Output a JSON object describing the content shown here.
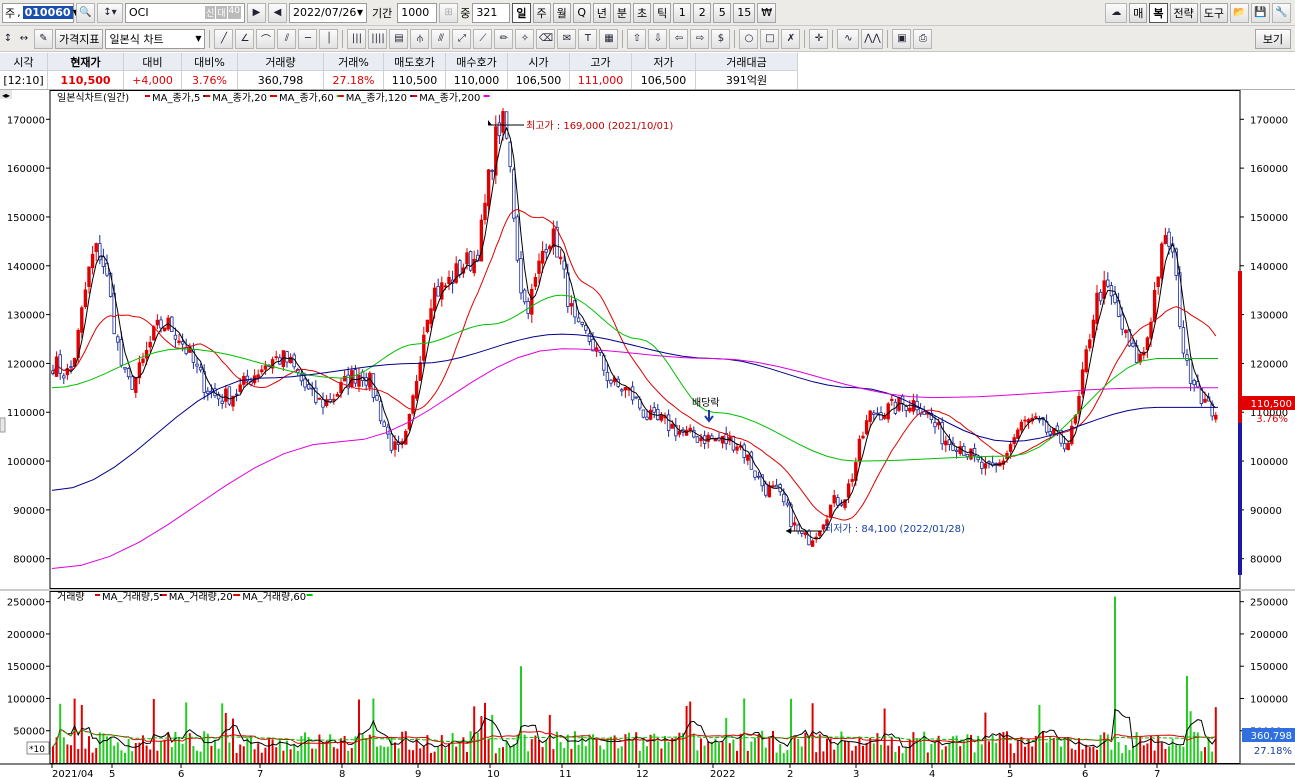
{
  "toolbar1": {
    "type_label": "주",
    "stock_code": "010060",
    "market_chars": [
      "신",
      "대",
      "40"
    ],
    "stock_name": "OCI",
    "date": "2022/07/26",
    "period_label": "기간",
    "period_value": "1000",
    "overlap_label": "중",
    "overlap_value": "321",
    "periods": [
      "일",
      "주",
      "월",
      "Q",
      "년",
      "분",
      "초",
      "틱",
      "1",
      "2",
      "5",
      "15",
      "₩"
    ],
    "active_period": "일",
    "right_buttons": [
      "매",
      "복",
      "전략",
      "도구"
    ]
  },
  "toolbar2": {
    "price_index_label": "가격지표",
    "chart_type": "일본식 차트",
    "view_label": "보기"
  },
  "quote": {
    "headers": [
      "시각",
      "현재가",
      "대비",
      "대비%",
      "거래량",
      "거래%",
      "매도호가",
      "매수호가",
      "시가",
      "고가",
      "저가",
      "거래대금"
    ],
    "values": [
      "[12:10]",
      "110,500",
      "+4,000",
      "3.76%",
      "360,798",
      "27.18%",
      "110,500",
      "110,000",
      "106,500",
      "111,000",
      "106,500",
      "391억원"
    ]
  },
  "chart": {
    "price_legend": "일본식차트(일간)",
    "price_ma": [
      {
        "name": "MA_종가,5",
        "color": "#000000"
      },
      {
        "name": "MA_종가,20",
        "color": "#e00000"
      },
      {
        "name": "MA_종가,60",
        "color": "#00c000"
      },
      {
        "name": "MA_종가,120",
        "color": "#00008b"
      },
      {
        "name": "MA_종가,200",
        "color": "#e000e0"
      }
    ],
    "volume_legend": "거래량",
    "volume_ma": [
      {
        "name": "MA_거래량,5",
        "color": "#000000"
      },
      {
        "name": "MA_거래량,20",
        "color": "#e00000"
      },
      {
        "name": "MA_거래량,60",
        "color": "#00c000"
      }
    ],
    "high_note": "최고가 : 169,000 (2021/10/01)",
    "low_note": "최저가 : 84,100 (2022/01/28)",
    "dividend_note": "배당락",
    "current_price": "110,500",
    "current_pct": "3.76%",
    "current_volume": "360,798",
    "volume_pct": "27.18%",
    "volume_unit": "*10",
    "price_ticks": [
      "170000",
      "160000",
      "150000",
      "140000",
      "130000",
      "120000",
      "110000",
      "100000",
      "90000",
      "80000"
    ],
    "volume_ticks": [
      "250000",
      "200000",
      "150000",
      "100000",
      "50000"
    ],
    "x_labels": [
      "2021/04",
      "5",
      "6",
      "7",
      "8",
      "9",
      "10",
      "11",
      "12",
      "2022",
      "2",
      "3",
      "4",
      "5",
      "6",
      "7"
    ]
  },
  "chart_data": {
    "type": "candlestick",
    "price_range": [
      74000,
      176000
    ],
    "volume_range": [
      0,
      265000
    ],
    "price_keypoints": [
      {
        "month": "2021/04",
        "price": 118000
      },
      {
        "month": "2021/04",
        "price": 143000
      },
      {
        "month": "5",
        "price": 116000
      },
      {
        "month": "5",
        "price": 128000
      },
      {
        "month": "6",
        "price": 113000
      },
      {
        "month": "7",
        "price": 121000
      },
      {
        "month": "7",
        "price": 112000
      },
      {
        "month": "8",
        "price": 118000
      },
      {
        "month": "8",
        "price": 102000
      },
      {
        "month": "9",
        "price": 135000
      },
      {
        "month": "9",
        "price": 141000
      },
      {
        "month": "10",
        "price": 169000
      },
      {
        "month": "10",
        "price": 132000
      },
      {
        "month": "10",
        "price": 146000
      },
      {
        "month": "11",
        "price": 126000
      },
      {
        "month": "11",
        "price": 115000
      },
      {
        "month": "12",
        "price": 108000
      },
      {
        "month": "12",
        "price": 105000
      },
      {
        "month": "2022",
        "price": 104000
      },
      {
        "month": "2022",
        "price": 94000
      },
      {
        "month": "2",
        "price": 84100
      },
      {
        "month": "2",
        "price": 92000
      },
      {
        "month": "3",
        "price": 110000
      },
      {
        "month": "3",
        "price": 112000
      },
      {
        "month": "4",
        "price": 104000
      },
      {
        "month": "4",
        "price": 98000
      },
      {
        "month": "5",
        "price": 108000
      },
      {
        "month": "5",
        "price": 104000
      },
      {
        "month": "6",
        "price": 135000
      },
      {
        "month": "6",
        "price": 121000
      },
      {
        "month": "7",
        "price": 145000
      },
      {
        "month": "7",
        "price": 118000
      },
      {
        "month": "7",
        "price": 110500
      }
    ],
    "ma60_keypoints": [
      {
        "month": "2021/04",
        "value": 115000
      },
      {
        "month": "6",
        "value": 123000
      },
      {
        "month": "8",
        "value": 117000
      },
      {
        "month": "9",
        "value": 124000
      },
      {
        "month": "10",
        "value": 128000
      },
      {
        "month": "11",
        "value": 134000
      },
      {
        "month": "12",
        "value": 125000
      },
      {
        "month": "2022",
        "value": 110000
      },
      {
        "month": "3",
        "value": 100000
      },
      {
        "month": "5",
        "value": 101000
      },
      {
        "month": "7",
        "value": 121000
      }
    ],
    "ma120_keypoints": [
      {
        "month": "2021/04",
        "value": 94000
      },
      {
        "month": "7",
        "value": 117000
      },
      {
        "month": "9",
        "value": 120000
      },
      {
        "month": "11",
        "value": 126000
      },
      {
        "month": "2022",
        "value": 121000
      },
      {
        "month": "3",
        "value": 115000
      },
      {
        "month": "5",
        "value": 104000
      },
      {
        "month": "7",
        "value": 111000
      }
    ],
    "ma200_keypoints": [
      {
        "month": "2021/04",
        "value": 78000
      },
      {
        "month": "8",
        "value": 104000
      },
      {
        "month": "11",
        "value": 123000
      },
      {
        "month": "2022",
        "value": 121000
      },
      {
        "month": "4",
        "value": 113000
      },
      {
        "month": "7",
        "value": 115000
      }
    ],
    "volume_peaks": [
      {
        "month": "2021/04",
        "value": 90000
      },
      {
        "month": "8",
        "value": 100000
      },
      {
        "month": "10",
        "value": 150000
      },
      {
        "month": "2022",
        "value": 100000
      },
      {
        "month": "5",
        "value": 90000
      },
      {
        "month": "6",
        "value": 258000
      },
      {
        "month": "7",
        "value": 135000
      }
    ]
  }
}
